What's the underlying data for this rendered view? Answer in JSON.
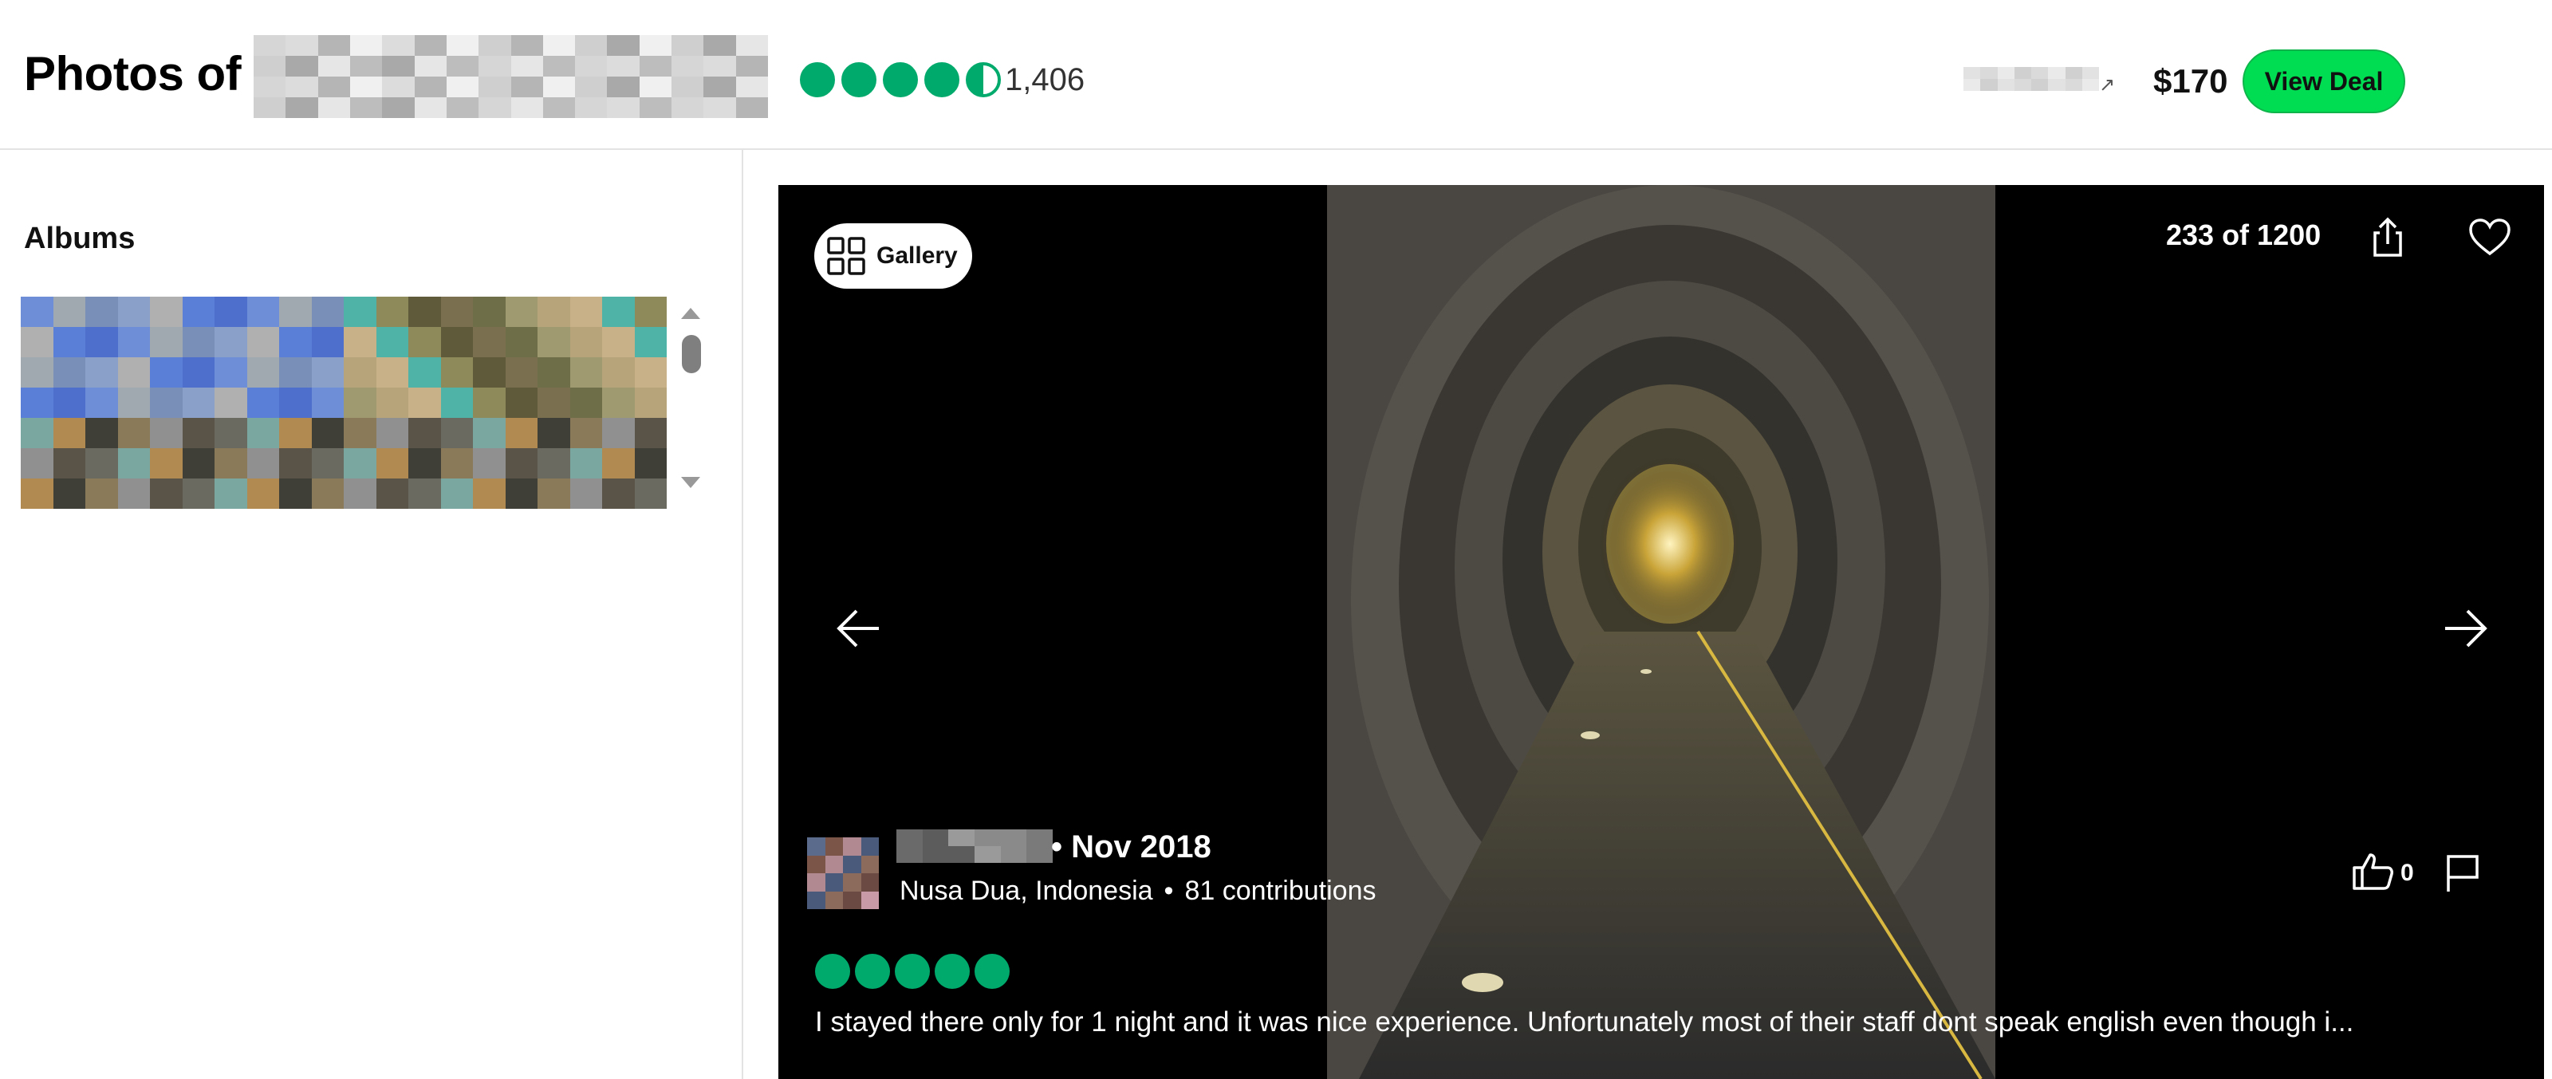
{
  "header": {
    "title": "Photos of",
    "review_count": "1,406",
    "rating_bubbles": 4.5,
    "price": "$170",
    "deal_button": "View Deal"
  },
  "sidebar": {
    "albums_title": "Albums"
  },
  "viewer": {
    "gallery_label": "Gallery",
    "counter": "233 of 1200",
    "review": {
      "date": "• Nov 2018",
      "location": "Nusa Dua, Indonesia",
      "separator": "•",
      "contributions": "81 contributions",
      "likes": "0",
      "rating_bubbles": 5,
      "text": "I stayed there only for 1 night and it was nice experience. Unfortunately most of their staff dont speak english even though i..."
    }
  },
  "colors": {
    "brand_green": "#00aa6c",
    "deal_button": "#00dd52"
  },
  "icons": [
    "external-link-icon",
    "gallery-grid-icon",
    "share-icon",
    "heart-icon",
    "arrow-left-icon",
    "arrow-right-icon",
    "thumbs-up-icon",
    "flag-icon"
  ]
}
